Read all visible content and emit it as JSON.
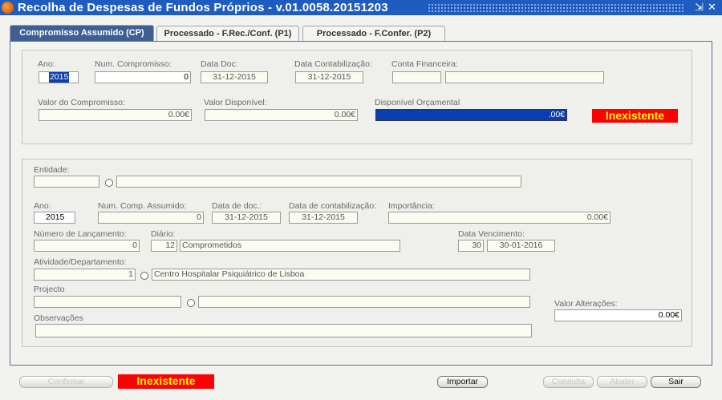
{
  "window": {
    "title": "Recolha de Despesas de Fundos Próprios - v.01.0058.20151203",
    "min_glyph": "⇲",
    "close_glyph": "✕"
  },
  "tabs": [
    {
      "label": "Compromisso Assumido (CP)"
    },
    {
      "label": "Processado - F.Rec./Conf. (P1)"
    },
    {
      "label": "Processado - F.Confer. (P2)"
    }
  ],
  "top": {
    "ano_label": "Ano:",
    "ano_value": "2015",
    "num_comp_label": "Num. Compromisso:",
    "num_comp_value": "0",
    "data_doc_label": "Data Doc:",
    "data_doc_value": "31-12-2015",
    "data_cont_label": "Data Contabilização:",
    "data_cont_value": "31-12-2015",
    "conta_label": "Conta Financeira:",
    "conta_code": "",
    "conta_desc": "",
    "valor_comp_label": "Valor do Compromisso:",
    "valor_comp_value": "0.00€",
    "valor_disp_label": "Valor Disponível:",
    "valor_disp_value": "0.00€",
    "disp_orc_label": "Disponível Orçamental",
    "disp_orc_value": ".00€",
    "status": "Inexistente"
  },
  "bottom": {
    "entidade_label": "Entidade:",
    "entidade_code": "",
    "entidade_name": "",
    "ano_label": "Ano:",
    "ano_value": "2015",
    "num_comp_label": "Num. Comp. Assumido:",
    "num_comp_value": "0",
    "data_doc_label": "Data de doc.:",
    "data_doc_value": "31-12-2015",
    "data_cont_label": "Data de contabilização:",
    "data_cont_value": "31-12-2015",
    "importancia_label": "Importância:",
    "importancia_value": "0.00€",
    "num_lanc_label": "Número de Lançamento:",
    "num_lanc_value": "0",
    "diario_label": "Diário:",
    "diario_code": "12",
    "diario_name": "Comprometidos",
    "data_venc_label": "Data Vencimento:",
    "data_venc_days": "30",
    "data_venc_date": "30-01-2016",
    "atividade_label": "Atividade/Departamento:",
    "atividade_code": "1",
    "atividade_name": "Centro Hospitalar Psiquiátrico de Lisboa",
    "projecto_label": "Projecto",
    "projecto_code": "",
    "projecto_name": "",
    "valor_alt_label": "Valor Alterações:",
    "valor_alt_value": "0.00€",
    "obs_label": "Observações",
    "obs_value": ""
  },
  "footer": {
    "confirmar_label": "Confirmar",
    "status": "Inexistente",
    "importar_label": "Importar",
    "consulta_label": "Consulta",
    "abater_label": "Abater",
    "sair_label": "Sair"
  },
  "colors": {
    "title_bar": "#1f5cc0",
    "active_tab": "#3f5f93",
    "status_bg": "#ff0000",
    "status_text": "#ffff00",
    "highlight_field": "#0a3fb0"
  }
}
